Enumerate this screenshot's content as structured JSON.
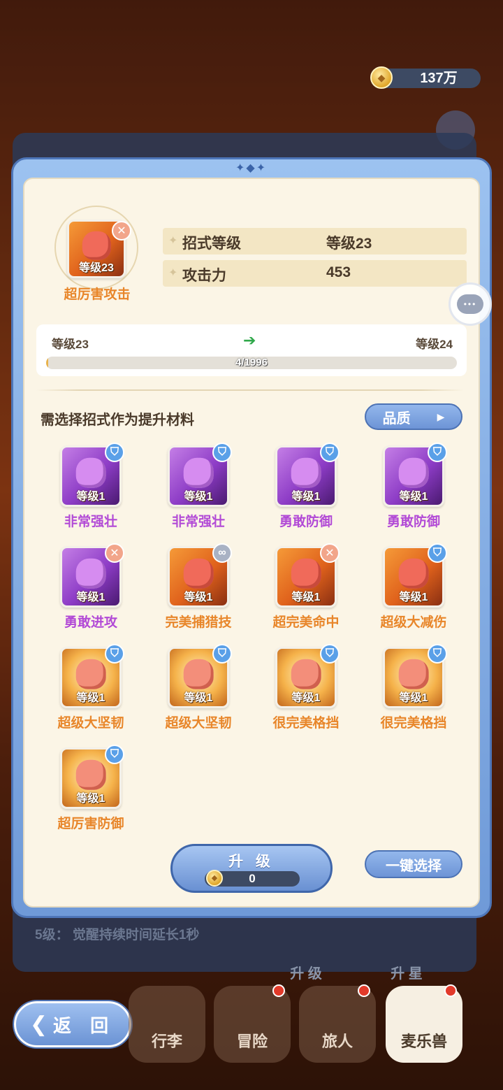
{
  "currency": {
    "amount": "137万",
    "icon": "coin-icon"
  },
  "main_skill": {
    "name": "超厉害攻击",
    "level": "等级23"
  },
  "stats": [
    {
      "label": "招式等级",
      "value": "等级23"
    },
    {
      "label": "攻击力",
      "value": "453"
    }
  ],
  "exp": {
    "from": "等级23",
    "to": "等级24",
    "text": "4/1996",
    "progress": 0.002
  },
  "section_title": "需选择招式作为提升材料",
  "quality_button": "品质",
  "materials": [
    {
      "name": "非常强壮",
      "level": "等级1",
      "style": "purple",
      "badge": "shield"
    },
    {
      "name": "非常强壮",
      "level": "等级1",
      "style": "purple",
      "badge": "shield"
    },
    {
      "name": "勇敢防御",
      "level": "等级1",
      "style": "purple",
      "badge": "shield"
    },
    {
      "name": "勇敢防御",
      "level": "等级1",
      "style": "purple",
      "badge": "shield"
    },
    {
      "name": "勇敢进攻",
      "level": "等级1",
      "style": "purple",
      "badge": "cross"
    },
    {
      "name": "完美捕猎技",
      "level": "等级1",
      "style": "orange",
      "badge": "link"
    },
    {
      "name": "超完美命中",
      "level": "等级1",
      "style": "orange",
      "badge": "cross"
    },
    {
      "name": "超级大减伤",
      "level": "等级1",
      "style": "orange",
      "badge": "shield"
    },
    {
      "name": "超级大坚韧",
      "level": "等级1",
      "style": "gold",
      "badge": "shield"
    },
    {
      "name": "超级大坚韧",
      "level": "等级1",
      "style": "gold",
      "badge": "shield"
    },
    {
      "name": "很完美格挡",
      "level": "等级1",
      "style": "gold",
      "badge": "shield"
    },
    {
      "name": "很完美格挡",
      "level": "等级1",
      "style": "gold",
      "badge": "shield"
    },
    {
      "name": "超厉害防御",
      "level": "等级1",
      "style": "gold",
      "badge": "shield"
    }
  ],
  "upgrade": {
    "label": "升 级",
    "cost": "0"
  },
  "one_click_select": "一键选择",
  "background_panel": {
    "text": "5级： 觉醒持续时间延长1秒",
    "tabs": [
      "升 级",
      "升 星"
    ]
  },
  "nav": {
    "back": "返 回",
    "tabs": [
      "行李",
      "冒险",
      "旅人",
      "麦乐兽"
    ]
  }
}
